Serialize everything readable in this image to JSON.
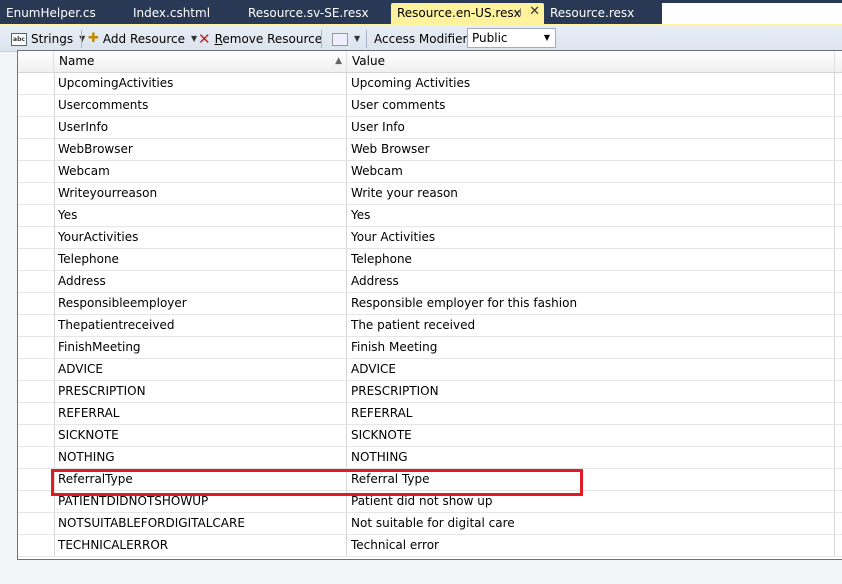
{
  "tabs": [
    {
      "label": "EnumHelper.cs",
      "active": false
    },
    {
      "label": "Index.cshtml",
      "active": false
    },
    {
      "label": "Resource.sv-SE.resx",
      "active": false
    },
    {
      "label": "Resource.en-US.resx",
      "active": true,
      "pin": "⊣",
      "close": "✕"
    },
    {
      "label": "Resource.resx",
      "active": false
    }
  ],
  "toolbar": {
    "strings_label": "Strings",
    "add_resource_label": "Add Resource",
    "remove_resource_prefix": "R",
    "remove_resource_rest": "emove Resource",
    "access_modifier_label": "Access Modifier:",
    "access_modifier_value": "Public"
  },
  "grid": {
    "columns": [
      "Name",
      "Value"
    ],
    "rows": [
      {
        "name": "UpcomingActivities",
        "value": "Upcoming Activities"
      },
      {
        "name": "Usercomments",
        "value": "User comments"
      },
      {
        "name": "UserInfo",
        "value": "User Info"
      },
      {
        "name": "WebBrowser",
        "value": "Web Browser"
      },
      {
        "name": "Webcam",
        "value": "Webcam"
      },
      {
        "name": "Writeyourreason",
        "value": "Write your reason"
      },
      {
        "name": "Yes",
        "value": "Yes"
      },
      {
        "name": "YourActivities",
        "value": "Your Activities"
      },
      {
        "name": "Telephone",
        "value": "Telephone"
      },
      {
        "name": "Address",
        "value": "Address"
      },
      {
        "name": "Responsibleemployer",
        "value": "Responsible employer for this fashion"
      },
      {
        "name": "Thepatientreceived",
        "value": "The patient received"
      },
      {
        "name": "FinishMeeting",
        "value": "Finish Meeting"
      },
      {
        "name": "ADVICE",
        "value": "ADVICE"
      },
      {
        "name": "PRESCRIPTION",
        "value": "PRESCRIPTION"
      },
      {
        "name": "REFERRAL",
        "value": "REFERRAL"
      },
      {
        "name": "SICKNOTE",
        "value": "SICKNOTE"
      },
      {
        "name": "NOTHING",
        "value": "NOTHING"
      },
      {
        "name": "ReferralType",
        "value": "Referral Type"
      },
      {
        "name": "PATIENTDIDNOTSHOWUP",
        "value": "Patient did not show up"
      },
      {
        "name": "NOTSUITABLEFORDIGITALCARE",
        "value": "Not suitable for digital care"
      },
      {
        "name": "TECHNICALERROR",
        "value": "Technical error"
      }
    ]
  },
  "colors": {
    "tabbar_bg": "#293955",
    "active_tab_bg": "#fff29d",
    "highlight_border": "#e01b24"
  },
  "icons": {
    "strings": "abc-string-icon",
    "add": "add-resource-icon",
    "remove": "remove-x-icon",
    "views": "grid-view-icon"
  }
}
